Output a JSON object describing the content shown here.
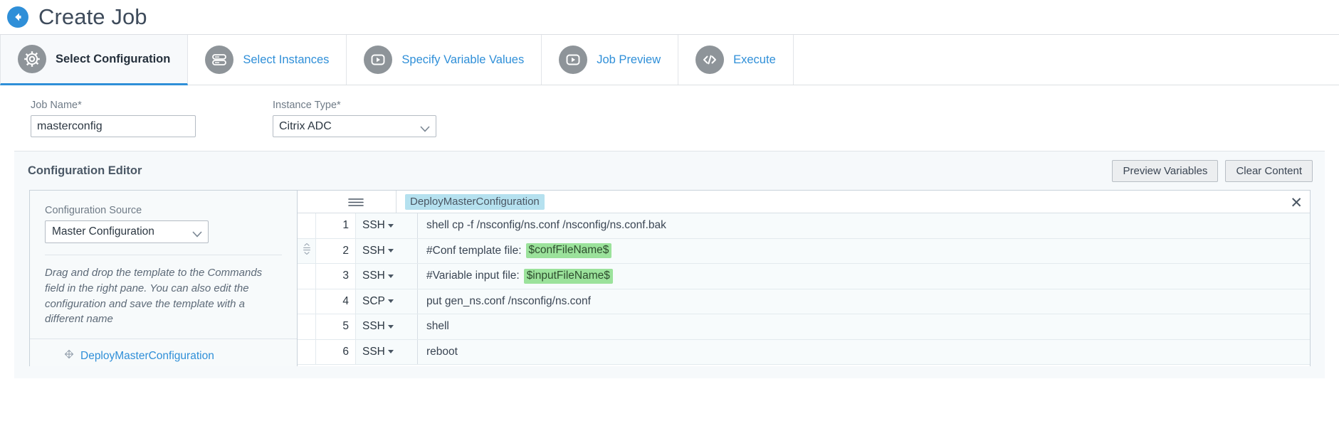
{
  "header": {
    "back_icon": "back-arrow-icon",
    "title": "Create Job"
  },
  "wizard": {
    "tabs": [
      {
        "label": "Select Configuration",
        "icon": "gear-icon",
        "active": true
      },
      {
        "label": "Select Instances",
        "icon": "server-stack-icon",
        "active": false
      },
      {
        "label": "Specify Variable Values",
        "icon": "play-box-icon",
        "active": false
      },
      {
        "label": "Job Preview",
        "icon": "play-box-icon",
        "active": false
      },
      {
        "label": "Execute",
        "icon": "code-brackets-icon",
        "active": false
      }
    ]
  },
  "form": {
    "job_name": {
      "label": "Job Name*",
      "value": "masterconfig",
      "placeholder": ""
    },
    "instance_type": {
      "label": "Instance Type*",
      "value": "Citrix ADC"
    }
  },
  "config_editor": {
    "title": "Configuration Editor",
    "preview_variables_label": "Preview Variables",
    "clear_content_label": "Clear Content",
    "left_pane": {
      "source_label": "Configuration Source",
      "source_value": "Master Configuration",
      "hint": "Drag and drop the template to the Commands field in the right pane. You can also edit the configuration and save the template with a different name",
      "template_name": "DeployMasterConfiguration"
    },
    "grid": {
      "header_chip": "DeployMasterConfiguration",
      "burger_icon": "hamburger-menu-icon",
      "close_icon": "close-icon",
      "rows": [
        {
          "num": "1",
          "protocol": "SSH",
          "text": "shell cp -f /nsconfig/ns.conf /nsconfig/ns.conf.bak",
          "variable": "",
          "draggable": false
        },
        {
          "num": "2",
          "protocol": "SSH",
          "text": "#Conf template file:",
          "variable": "$confFileName$",
          "draggable": true
        },
        {
          "num": "3",
          "protocol": "SSH",
          "text": "#Variable input file:",
          "variable": "$inputFileName$",
          "draggable": false
        },
        {
          "num": "4",
          "protocol": "SCP",
          "text": "put gen_ns.conf /nsconfig/ns.conf",
          "variable": "",
          "draggable": false
        },
        {
          "num": "5",
          "protocol": "SSH",
          "text": "shell",
          "variable": "",
          "draggable": false
        },
        {
          "num": "6",
          "protocol": "SSH",
          "text": "reboot",
          "variable": "",
          "draggable": false
        }
      ]
    }
  },
  "colors": {
    "accent": "#2f8fd8",
    "chip_blue": "#b5e1ef",
    "chip_green": "#9be29b",
    "panel_bg": "#f6f9fb"
  }
}
